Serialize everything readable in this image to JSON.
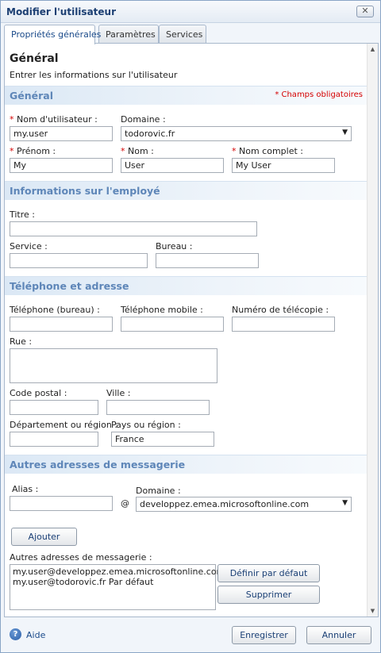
{
  "window": {
    "title": "Modifier l'utilisateur",
    "close_glyph": "✕"
  },
  "tabs": [
    {
      "label": "Propriétés générales",
      "active": true
    },
    {
      "label": "Paramètres",
      "active": false
    },
    {
      "label": "Services",
      "active": false
    }
  ],
  "page": {
    "heading": "Général",
    "subheading": "Entrer les informations sur l'utilisateur"
  },
  "general": {
    "title": "Général",
    "required_note": "* Champs obligatoires",
    "required_mark": "*",
    "username_label": "Nom d'utilisateur :",
    "username_value": "my.user",
    "domain_label": "Domaine :",
    "domain_value": "todorovic.fr",
    "firstname_label": "Prénom :",
    "firstname_value": "My",
    "lastname_label": "Nom :",
    "lastname_value": "User",
    "fullname_label": "Nom complet :",
    "fullname_value": "My User"
  },
  "employee": {
    "title": "Informations sur l'employé",
    "title_label": "Titre :",
    "title_value": "",
    "service_label": "Service :",
    "service_value": "",
    "office_label": "Bureau :",
    "office_value": ""
  },
  "phone": {
    "title": "Téléphone et adresse",
    "office_phone_label": "Téléphone (bureau) :",
    "mobile_label": "Téléphone mobile :",
    "fax_label": "Numéro de télécopie :",
    "street_label": "Rue :",
    "zip_label": "Code postal :",
    "city_label": "Ville :",
    "state_label": "Département ou région :",
    "country_label": "Pays ou région :",
    "country_value": "France"
  },
  "email": {
    "title": "Autres adresses de messagerie",
    "alias_label": "Alias :",
    "alias_value": "",
    "at_sign": "@",
    "domain_label": "Domaine :",
    "domain_value": "developpez.emea.microsoftonline.com",
    "add_button": "Ajouter",
    "list_label": "Autres adresses de messagerie :",
    "addresses": [
      "my.user@developpez.emea.microsoftonline.com",
      "my.user@todorovic.fr Par défaut"
    ],
    "set_default_button": "Définir par défaut",
    "delete_button": "Supprimer"
  },
  "footer": {
    "help_glyph": "?",
    "help_label": "Aide",
    "save_button": "Enregistrer",
    "cancel_button": "Annuler"
  },
  "icons": {
    "dropdown_arrow": "▼",
    "scroll_up": "▲",
    "scroll_down": "▼"
  },
  "colors": {
    "accent": "#1c3f73",
    "section_title": "#5e86b8",
    "required": "#d40000"
  }
}
